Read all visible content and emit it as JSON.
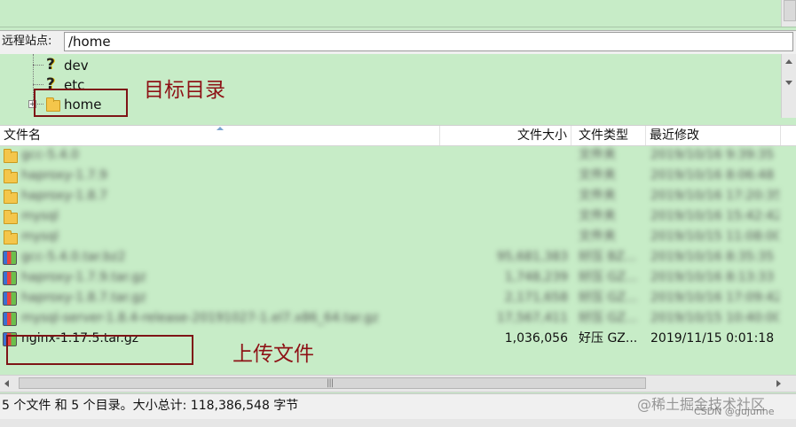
{
  "remote": {
    "label": "远程站点:",
    "path": "/home"
  },
  "tree": {
    "items": [
      {
        "label": "dev",
        "icon": "unknown-folder-icon"
      },
      {
        "label": "etc",
        "icon": "unknown-folder-icon"
      },
      {
        "label": "home",
        "icon": "folder-icon",
        "expander": "+"
      }
    ]
  },
  "annotations": {
    "target_dir": "目标目录",
    "upload_file": "上传文件"
  },
  "list": {
    "columns": [
      "文件名",
      "文件大小",
      "文件类型",
      "最近修改"
    ],
    "rows": [
      {
        "kind": "folder",
        "name": "gcc-5.4.0",
        "size": "",
        "type": "文件夹",
        "modified": "2019/10/16 9:39:35",
        "blurred": true
      },
      {
        "kind": "folder",
        "name": "haproxy-1.7.9",
        "size": "",
        "type": "文件夹",
        "modified": "2019/10/16 8:06:48",
        "blurred": true
      },
      {
        "kind": "folder",
        "name": "haproxy-1.8.7",
        "size": "",
        "type": "文件夹",
        "modified": "2019/10/16 17:20:35",
        "blurred": true
      },
      {
        "kind": "folder",
        "name": "mysql",
        "size": "",
        "type": "文件夹",
        "modified": "2019/10/16 15:42:42",
        "blurred": true
      },
      {
        "kind": "folder",
        "name": "mysql",
        "size": "",
        "type": "文件夹",
        "modified": "2019/10/15 11:08:00",
        "blurred": true
      },
      {
        "kind": "archive",
        "name": "gcc-5.4.0.tar.bz2",
        "size": "95,681,383",
        "type": "好压 BZ...",
        "modified": "2019/10/16 8:35:35",
        "blurred": true
      },
      {
        "kind": "archive",
        "name": "haproxy-1.7.9.tar.gz",
        "size": "1,748,239",
        "type": "好压 GZ...",
        "modified": "2019/10/16 8:13:33",
        "blurred": true
      },
      {
        "kind": "archive",
        "name": "haproxy-1.8.7.tar.gz",
        "size": "2,171,658",
        "type": "好压 GZ...",
        "modified": "2019/10/16 17:09:42",
        "blurred": true
      },
      {
        "kind": "archive",
        "name": "mysql-server-1.8.4-release-20191027-1.el7.x86_64.tar.gz",
        "size": "17,567,411",
        "type": "好压 GZ...",
        "modified": "2019/10/15 10:40:00",
        "blurred": true
      },
      {
        "kind": "archive",
        "name": "nginx-1.17.5.tar.gz",
        "size": "1,036,056",
        "type": "好压 GZ...",
        "modified": "2019/11/15 0:01:18",
        "blurred": false
      }
    ]
  },
  "status": {
    "text": "5 个文件 和 5 个目录。大小总计: 118,386,548 字节"
  },
  "watermark": {
    "main": "@稀土掘金技术社区",
    "sub": "CSDN @gujunhe"
  },
  "colors": {
    "pane_bg": "#c7ecc7",
    "annotation": "#8e1216"
  }
}
